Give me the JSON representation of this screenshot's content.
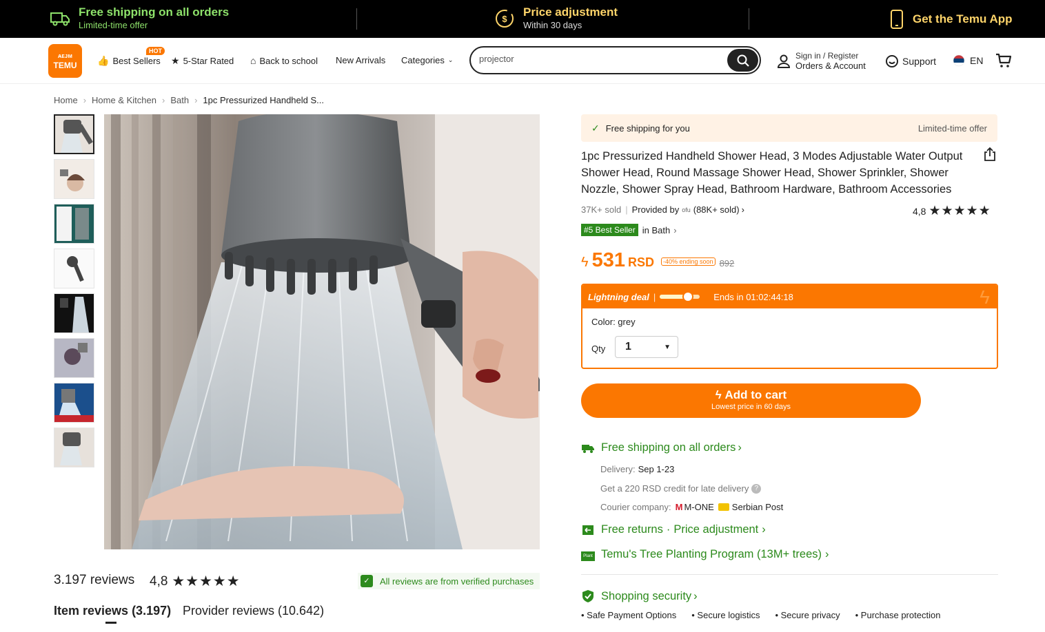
{
  "promo": {
    "shipping_title": "Free shipping on all orders",
    "shipping_sub": "Limited-time offer",
    "price_title": "Price adjustment",
    "price_sub": "Within 30 days",
    "app_label": "Get the Temu App"
  },
  "header": {
    "logo_text_top": "ᴀᴇᴊᴍ",
    "logo_text": "TEMU",
    "nav": {
      "best_sellers": "Best Sellers",
      "hot_badge": "HOT",
      "five_star": "5-Star Rated",
      "back_to_school": "Back to school",
      "new_arrivals": "New Arrivals",
      "categories": "Categories"
    },
    "search": {
      "value": "projector"
    },
    "account": {
      "sign_in": "Sign in / Register",
      "orders": "Orders & Account"
    },
    "support": "Support",
    "language": "EN"
  },
  "breadcrumb": [
    "Home",
    "Home & Kitchen",
    "Bath",
    "1pc Pressurized Handheld S..."
  ],
  "product": {
    "free_shipping": "Free shipping for you",
    "limited_offer": "Limited-time offer",
    "title": "1pc Pressurized Handheld Shower Head, 3 Modes Adjustable Water Output Shower Head, Round Massage Shower Head, Shower Sprinkler, Shower Nozzle, Shower Spray Head, Bathroom Hardware, Bathroom Accessories",
    "sold": "37K+ sold",
    "provided_by": "Provided by",
    "provider_logo": "ofu",
    "provider_sold": "(88K+ sold)",
    "rating": "4,8",
    "stars": "★★★★★",
    "best_seller_badge": "#5 Best Seller",
    "best_seller_in": "in Bath",
    "price": "531",
    "currency": "RSD",
    "discount": "-40% ending soon",
    "old_price": "892",
    "deal_label": "Lightning deal",
    "deal_progress": 0.7,
    "deal_ends": "Ends in 01:02:44:18",
    "color": "Color: grey",
    "qty_label": "Qty",
    "qty_value": "1",
    "add_to_cart": "Add to cart",
    "cart_sub": "Lowest price in 60 days"
  },
  "shipping": {
    "free_shipping": "Free shipping on all orders",
    "delivery_label": "Delivery:",
    "delivery_value": "Sep 1-23",
    "credit": "Get a 220 RSD credit for late delivery",
    "courier_label": "Courier company:",
    "courier_1": "M-ONE",
    "courier_2": "Serbian Post",
    "returns": "Free returns",
    "dot": "·",
    "price_adjustment": "Price adjustment",
    "plant_icon": "Plant",
    "tree_program": "Temu's Tree Planting Program (13M+ trees)",
    "security": "Shopping security",
    "security_items": [
      "Safe Payment Options",
      "Secure logistics",
      "Secure privacy",
      "Purchase protection"
    ]
  },
  "reviews": {
    "count": "3.197 reviews",
    "rating": "4,8",
    "stars": "★★★★★",
    "verified": "All reviews are from verified purchases",
    "tab_items": "Item reviews (3.197)",
    "tab_provider": "Provider reviews (10.642)"
  },
  "colors": {
    "accent": "#fb7701",
    "green": "#2c8a1c",
    "promo_bg": "#000000"
  },
  "icons": [
    "truck-icon",
    "dollar-clock-icon",
    "phone-icon",
    "search-icon",
    "user-icon",
    "support-icon",
    "flag-icon",
    "cart-icon",
    "share-icon",
    "check-icon",
    "bolt-icon",
    "shield-icon",
    "chevron-right-icon"
  ]
}
